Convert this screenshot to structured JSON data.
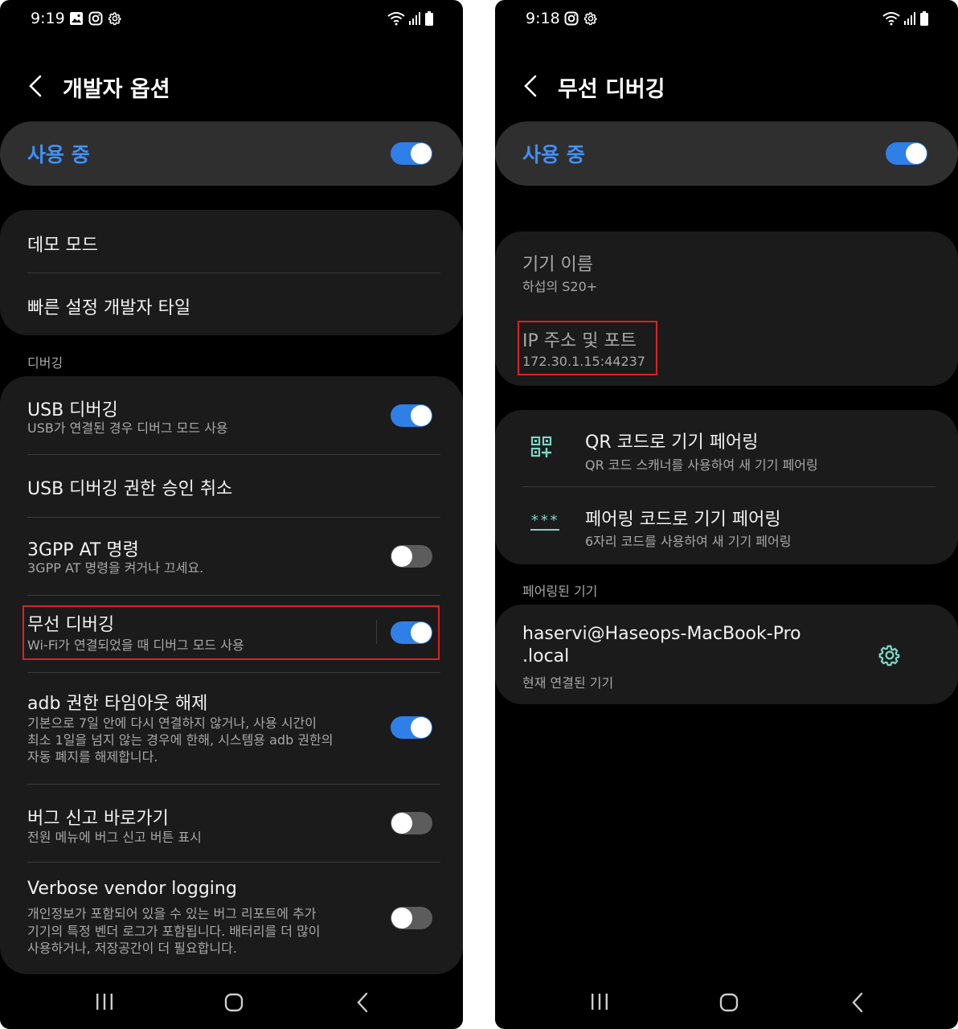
{
  "left": {
    "status": {
      "time": "9:19",
      "icons": [
        "image-icon",
        "instagram-icon",
        "gear-icon"
      ]
    },
    "header": {
      "title": "개발자 옵션"
    },
    "master": {
      "label": "사용 중",
      "on": true
    },
    "group1": {
      "items": [
        {
          "title": "데모 모드"
        },
        {
          "title": "빠른 설정 개발자 타일"
        }
      ]
    },
    "debug_section": "디버깅",
    "debug_items": [
      {
        "title": "USB 디버깅",
        "sub": "USB가 연결된 경우 디버그 모드 사용",
        "toggle": "on"
      },
      {
        "title": "USB 디버깅 권한 승인 취소"
      },
      {
        "title": "3GPP AT 명령",
        "sub": "3GPP AT 명령을 켜거나 끄세요.",
        "toggle": "off"
      },
      {
        "title": "무선 디버깅",
        "sub": "Wi-Fi가 연결되었을 때 디버그 모드 사용",
        "toggle": "on"
      },
      {
        "title": "adb 권한 타임아웃 해제",
        "sub1": "기본으로 7일 안에 다시 연결하지 않거나, 사용 시간이",
        "sub2": "최소 1일을 넘지 않는 경우에 한해, 시스템용 adb 권한의",
        "sub3": "자동 폐지를 해제합니다.",
        "toggle": "on"
      },
      {
        "title": "버그 신고 바로가기",
        "sub": "전원 메뉴에 버그 신고 버튼 표시",
        "toggle": "off"
      },
      {
        "title": "Verbose vendor logging",
        "sub1": "개인정보가 포함되어 있을 수 있는 버그 리포트에 추가",
        "sub2": "기기의 특정 벤더 로그가 포함됩니다. 배터리를 더 많이",
        "sub3": "사용하거나, 저장공간이 더 필요합니다.",
        "toggle": "off"
      }
    ]
  },
  "right": {
    "status": {
      "time": "9:18",
      "icons": [
        "instagram-icon",
        "gear-icon"
      ]
    },
    "header": {
      "title": "무선 디버깅"
    },
    "master": {
      "label": "사용 중",
      "on": true
    },
    "device_name": {
      "title": "기기 이름",
      "value": "하섭의 S20+"
    },
    "ip_port": {
      "title": "IP 주소 및 포트",
      "value": "172.30.1.15:44237"
    },
    "pairing": [
      {
        "title": "QR 코드로 기기 페어링",
        "sub": "QR 코드 스캐너를 사용하여 새 기기 페어링",
        "icon": "qr-code-icon"
      },
      {
        "title": "페어링 코드로 기기 페어링",
        "sub": "6자리 코드를 사용하여 새 기기 페어링",
        "icon": "password-dots-icon",
        "icon_text": "***"
      }
    ],
    "paired_section": "페어링된 기기",
    "paired_device": {
      "line1": "haservi@Haseops-MacBook-Pro",
      "line2": ".local",
      "sub": "현재 연결된 기기"
    }
  },
  "colors": {
    "accent_blue": "#3e91ff",
    "toggle_on": "#2f7fe8",
    "highlight_red": "#e02020",
    "teal_icon": "#7fd6c8"
  }
}
